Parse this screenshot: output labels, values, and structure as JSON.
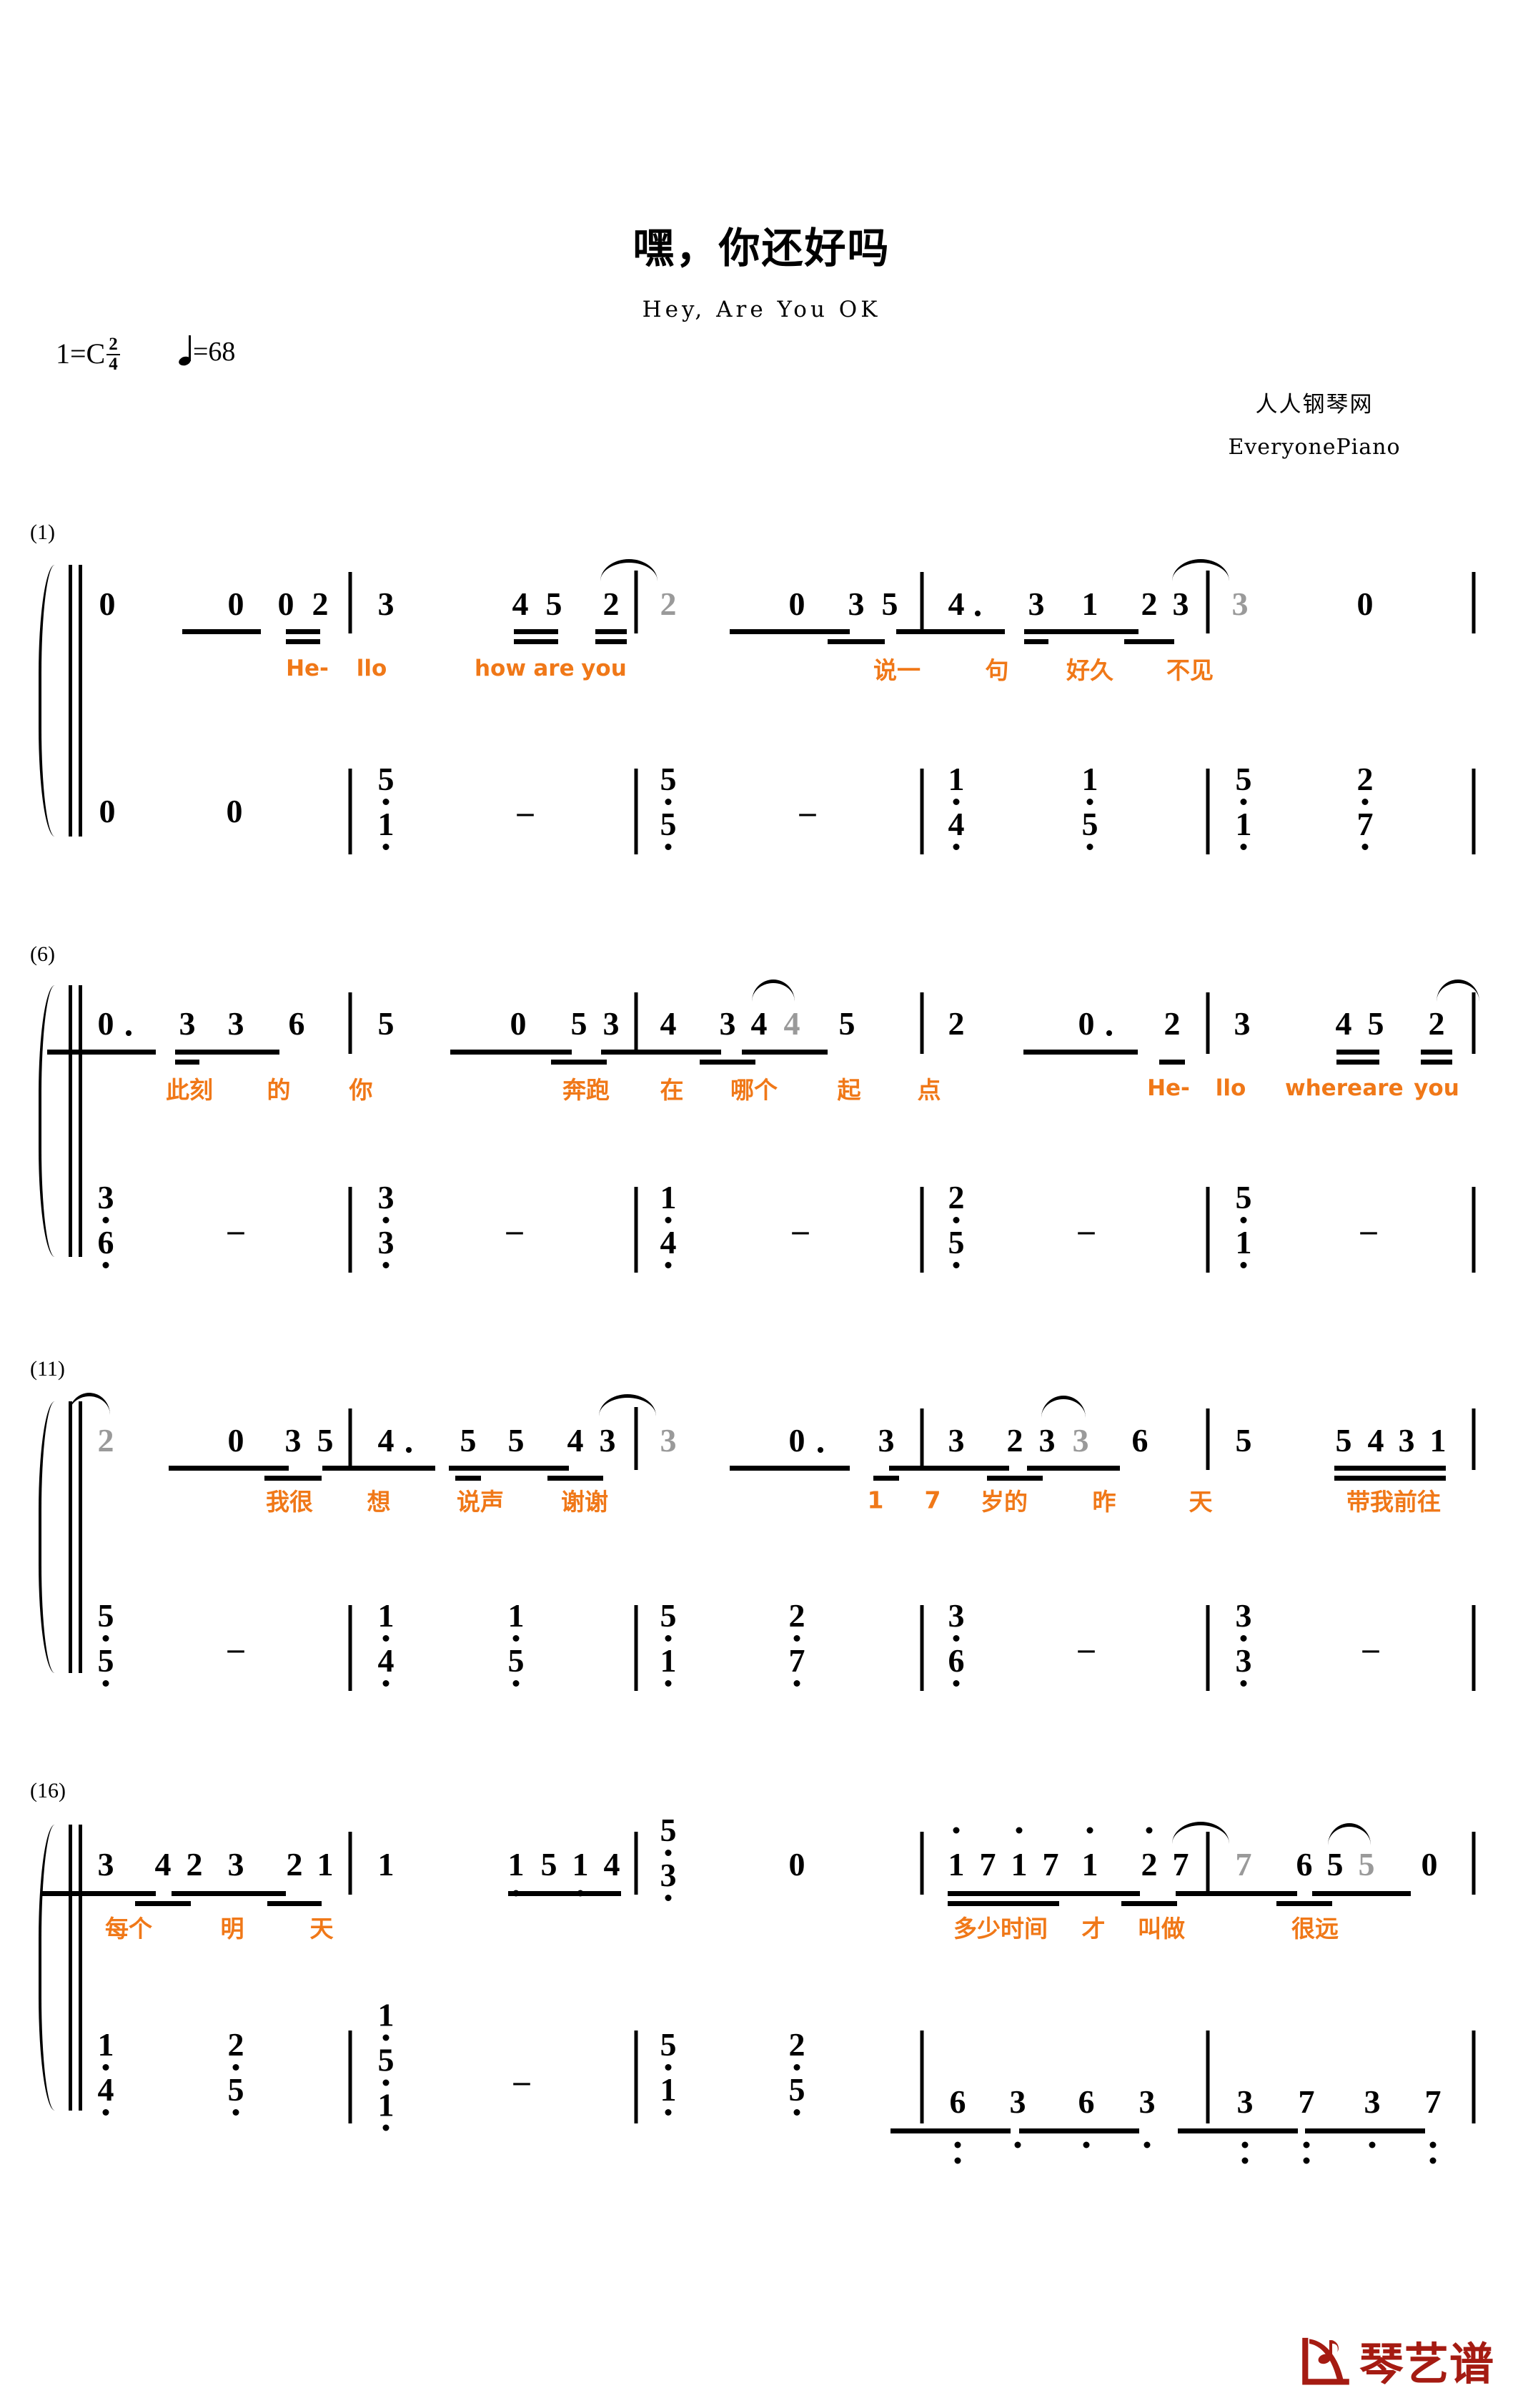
{
  "header": {
    "title": "嘿，你还好吗",
    "subtitle": "Hey, Are You OK",
    "key_label": "1=C",
    "time_num": "2",
    "time_den": "4",
    "tempo_eq": "=68",
    "credit_cn": "人人钢琴网",
    "credit_en": "EveryonePiano"
  },
  "footer": {
    "logo_text": "琴艺谱"
  },
  "colors": {
    "lyric": "#F07818",
    "tied_note": "#9a9a9a",
    "logo": "#A51B12",
    "ink": "#000000"
  },
  "systems": [
    {
      "number": "(1)",
      "melody": [
        "0",
        "0",
        "0",
        "2",
        "3",
        "4",
        "5",
        "2",
        "2",
        "0",
        "3",
        "5",
        "4·",
        "3",
        "1",
        "2",
        "3",
        "3",
        "0"
      ],
      "lyrics": [
        "He-",
        "llo",
        "how",
        "are",
        "you",
        "说一",
        "句",
        "好久",
        "不见"
      ],
      "bass": [
        "0",
        "0",
        "5/1",
        "-",
        "5/5",
        "-",
        "1/4",
        "1/5",
        "5/1",
        "2/7"
      ]
    },
    {
      "number": "(6)",
      "melody": [
        "0·",
        "3",
        "3",
        "6",
        "5",
        "0",
        "5",
        "3",
        "4",
        "3",
        "4",
        "4",
        "5",
        "2",
        "0·",
        "2",
        "3",
        "4",
        "5",
        "2"
      ],
      "lyrics": [
        "此刻",
        "的",
        "你",
        "奔跑",
        "在",
        "哪个",
        "起",
        "点",
        "He-",
        "llo",
        "where",
        "are",
        "you"
      ],
      "bass": [
        "3/6",
        "-",
        "3/3",
        "-",
        "1/4",
        "-",
        "2/5",
        "-",
        "5/1",
        "-"
      ]
    },
    {
      "number": "(11)",
      "melody": [
        "2",
        "0",
        "3",
        "5",
        "4·",
        "5",
        "5",
        "4",
        "3",
        "3",
        "0·",
        "3",
        "3",
        "2",
        "3",
        "3",
        "6",
        "5",
        "5",
        "4",
        "3",
        "1"
      ],
      "lyrics": [
        "我很",
        "想",
        "说声",
        "谢谢",
        "1",
        "7",
        "岁的",
        "昨",
        "天",
        "带我前往"
      ],
      "bass": [
        "5/5",
        "-",
        "1/4",
        "1/5",
        "5/1",
        "2/7",
        "3/6",
        "-",
        "3/3",
        "-"
      ]
    },
    {
      "number": "(16)",
      "melody": [
        "3",
        "4",
        "2",
        "3",
        "2",
        "1",
        "1",
        "1",
        "5",
        "1",
        "4",
        "5/3",
        "0",
        "1",
        "7",
        "1",
        "7",
        "1",
        "2",
        "7",
        "7",
        "6",
        "5",
        "5",
        "0"
      ],
      "lyrics": [
        "每个",
        "明",
        "天",
        "多少时间",
        "才",
        "叫做",
        "很远"
      ],
      "bass": [
        "1/4",
        "2/5",
        "1/5/1",
        "-",
        "5/1",
        "2/5",
        "6",
        "3",
        "6",
        "3",
        "3",
        "7",
        "3",
        "7"
      ]
    }
  ],
  "notation": {
    "type": "jianpu",
    "clef_pairs": 2,
    "measures_total": 20,
    "repeat_start": true
  }
}
